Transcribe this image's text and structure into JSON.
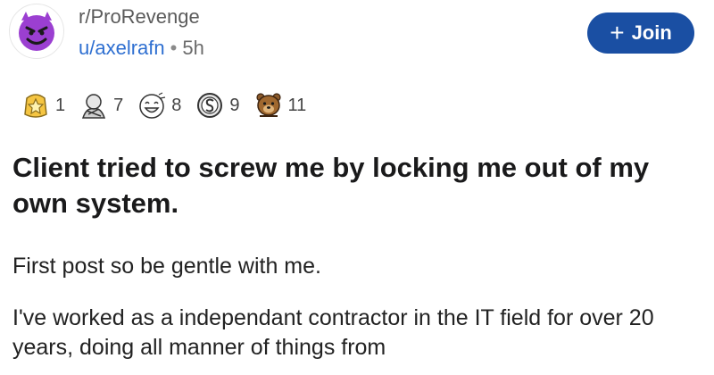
{
  "post": {
    "subreddit": "r/ProRevenge",
    "author": "u/axelrafn",
    "separator": "•",
    "age": "5h",
    "join": {
      "plus": "+",
      "label": "Join"
    },
    "awards": [
      {
        "icon": "gold-star-award-icon",
        "count": "1"
      },
      {
        "icon": "wholesome-award-icon",
        "count": "7"
      },
      {
        "icon": "laughing-award-icon",
        "count": "8"
      },
      {
        "icon": "silver-coin-award-icon",
        "count": "9"
      },
      {
        "icon": "bear-award-icon",
        "count": "11"
      }
    ],
    "title": "Client tried to screw me by locking me out of my own system.",
    "body": [
      "First post so be gentle with me.",
      "I've worked as a independant contractor in the IT field for over 20 years, doing all manner of things from"
    ]
  },
  "colors": {
    "join_button": "#1a4fa3",
    "author_link": "#2e6fd1",
    "avatar_face": "#9b3fd1"
  }
}
